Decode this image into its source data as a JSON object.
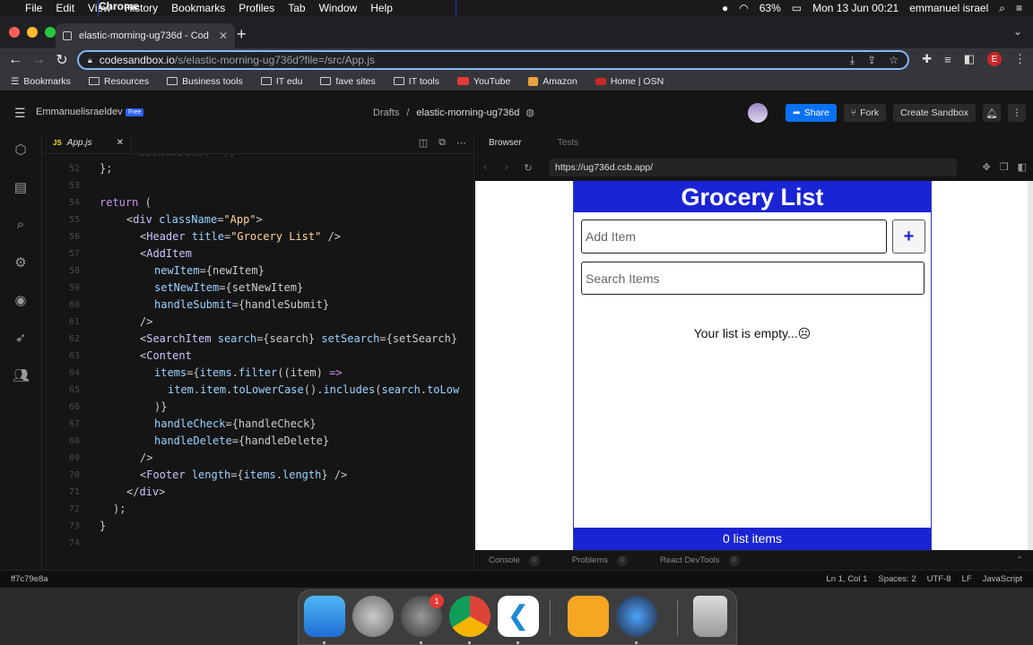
{
  "menubar": {
    "app": "Chrome",
    "items": [
      "File",
      "Edit",
      "View",
      "History",
      "Bookmarks",
      "Profiles",
      "Tab",
      "Window",
      "Help"
    ],
    "battery": "63%",
    "datetime": "Mon 13 Jun  00:21",
    "user": "emmanuel israel"
  },
  "chrome": {
    "tab_title": "elastic-morning-ug736d - Cod",
    "url_host": "codesandbox.io",
    "url_path": "/s/elastic-morning-ug736d?file=/src/App.js",
    "profile_letter": "E"
  },
  "bookmarks": [
    "Bookmarks",
    "Resources",
    "Business tools",
    "IT edu",
    "fave sites",
    "IT tools",
    "YouTube",
    "Amazon",
    "Home | OSN"
  ],
  "csb": {
    "user": "Emmanuelisraeldev",
    "plan": "Free",
    "drafts": "Drafts",
    "sandbox": "elastic-morning-ug736d",
    "share": "Share",
    "fork": "Fork",
    "create": "Create Sandbox"
  },
  "editor": {
    "tab": "App.js",
    "js_badge": "JS"
  },
  "code": {
    "line_numbers": [
      "52",
      "53",
      "54",
      "55",
      "56",
      "57",
      "58",
      "59",
      "60",
      "61",
      "62",
      "63",
      "64",
      "65",
      "66",
      "67",
      "68",
      "69",
      "70",
      "71",
      "72",
      "73",
      "74"
    ]
  },
  "preview": {
    "tabs": [
      "Browser",
      "Tests"
    ],
    "url": "https://ug736d.csb.app/",
    "header": "Grocery List",
    "add_placeholder": "Add Item",
    "add_button": "+",
    "search_placeholder": "Search Items",
    "empty_text": "Your list is empty...",
    "footer": "0 list items"
  },
  "console_tabs": [
    {
      "label": "Console",
      "count": "0"
    },
    {
      "label": "Problems",
      "count": "0"
    },
    {
      "label": "React DevTools",
      "count": "0"
    }
  ],
  "status": {
    "hash": "ff7c79e8a",
    "position": "Ln 1, Col 1",
    "spaces": "Spaces: 2",
    "encoding": "UTF-8",
    "eol": "LF",
    "language": "JavaScript"
  },
  "dock": {
    "badge": "1"
  }
}
